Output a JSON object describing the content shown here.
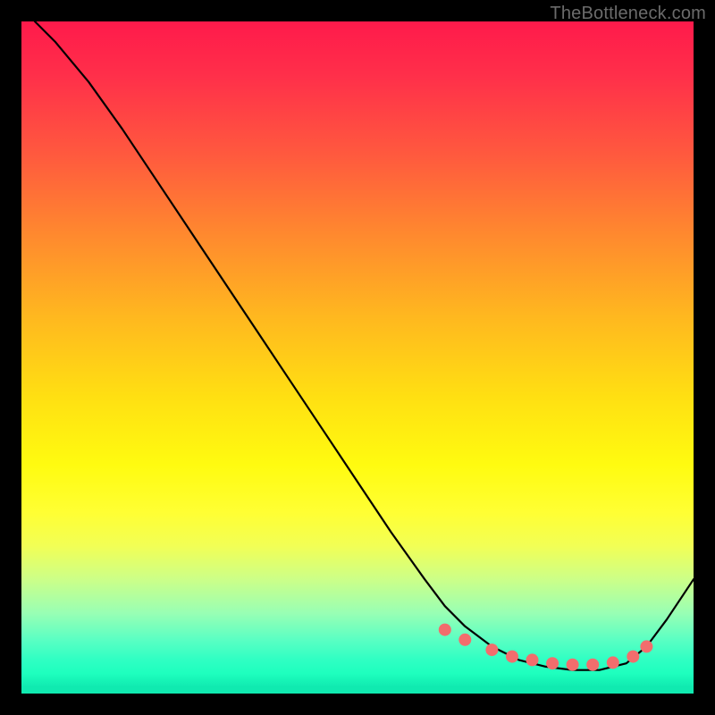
{
  "watermark": "TheBottleneck.com",
  "chart_data": {
    "type": "line",
    "title": "",
    "xlabel": "",
    "ylabel": "",
    "xlim": [
      0,
      100
    ],
    "ylim": [
      0,
      100
    ],
    "series": [
      {
        "name": "curve",
        "x": [
          2,
          5,
          10,
          15,
          20,
          25,
          30,
          35,
          40,
          45,
          50,
          55,
          60,
          63,
          66,
          70,
          74,
          78,
          82,
          86,
          90,
          93,
          96,
          100
        ],
        "values": [
          100,
          97,
          91,
          84,
          76.5,
          69,
          61.5,
          54,
          46.5,
          39,
          31.5,
          24,
          17,
          13,
          10,
          7,
          5,
          4,
          3.5,
          3.5,
          4.5,
          7,
          11,
          17
        ]
      }
    ],
    "markers": {
      "name": "dots",
      "color": "#f26d6d",
      "x": [
        63,
        66,
        70,
        73,
        76,
        79,
        82,
        85,
        88,
        91,
        93
      ],
      "values": [
        9.5,
        8,
        6.5,
        5.5,
        5,
        4.5,
        4.3,
        4.3,
        4.6,
        5.5,
        7
      ]
    }
  }
}
